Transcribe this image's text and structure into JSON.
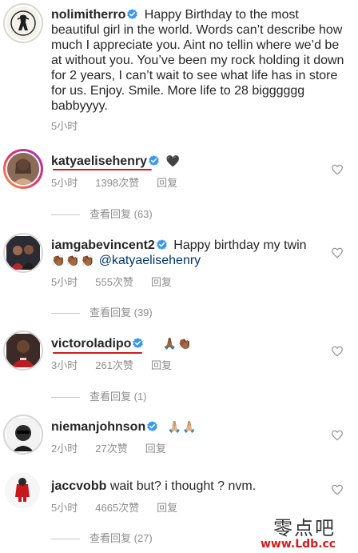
{
  "caption": {
    "username": "nolimitherro",
    "text": "Happy Birthday to the most beautiful girl in the world. Words can’t describe how much I appreciate you. Aint no tellin where we’d be at without you. You’ve been my rock holding it down for 2 years, I can’t wait to see what life has in store for us. Enjoy. Smile. More life to 28 bigggggg babbyyyy.",
    "time": "5小时"
  },
  "comments": [
    {
      "username": "katyaelisehenry",
      "text": "🖤",
      "time": "5小时",
      "likes": "1398次赞",
      "reply_label": "回复",
      "view_replies": "查看回复 (63)"
    },
    {
      "username": "iamgabevincent2",
      "text": "Happy birthday my twin",
      "emoji": "👏🏾👏🏾👏🏾",
      "mention": "@katyaelisehenry",
      "time": "5小时",
      "likes": "555次赞",
      "reply_label": "回复",
      "view_replies": "查看回复 (39)"
    },
    {
      "username": "victoroladipo",
      "text": "🙏🏾👏🏾",
      "time": "3小时",
      "likes": "261次赞",
      "reply_label": "回复",
      "view_replies": "查看回复 (1)"
    },
    {
      "username": "niemanjohnson",
      "text": "🙏🏼🙏🏼",
      "time": "2小时",
      "likes": "27次赞",
      "reply_label": "回复"
    },
    {
      "username": "jaccvobb",
      "text": "wait but? i thought ? nvm.",
      "time": "5小时",
      "likes": "4665次赞",
      "reply_label": "回复",
      "view_replies": "查看回复 (27)"
    }
  ],
  "watermark": {
    "logo": "零点吧",
    "url": "www.Ldb.cc"
  },
  "icons": {
    "verified": "verified-badge-icon",
    "like": "heart-outline-icon"
  },
  "colors": {
    "verified": "#3897f0",
    "meta_text": "#8e8e8e",
    "mention": "#00376b",
    "underline": "#d11b1b",
    "watermark_url": "#d91a1a"
  }
}
